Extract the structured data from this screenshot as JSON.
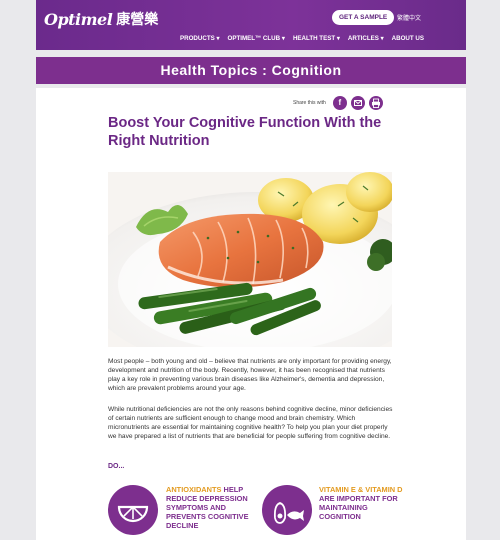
{
  "brand": {
    "name_en": "Optimel",
    "name_zh": "康營樂"
  },
  "header": {
    "get_sample": "GET A SAMPLE",
    "language": "繁體中文"
  },
  "nav": {
    "items": [
      {
        "label": "PRODUCTS ▾"
      },
      {
        "label": "OPTIMEL™ CLUB ▾"
      },
      {
        "label": "HEALTH TEST ▾"
      },
      {
        "label": "ARTICLES ▾"
      },
      {
        "label": "ABOUT US"
      }
    ]
  },
  "banner": {
    "title": "Health Topics : Cognition"
  },
  "share": {
    "label": "Share this with",
    "icons": [
      "facebook-icon",
      "email-icon",
      "print-icon"
    ]
  },
  "article": {
    "title": "Boost Your Cognitive Function With the Right Nutrition",
    "hero_image": "salmon fillet with green beans and potatoes",
    "paragraphs": [
      "Most people – both young and old – believe that nutrients are only important for providing energy, development and nutrition of the body. Recently, however, it has been recognised that nutrients play a key role in preventing various brain diseases like Alzheimer's, dementia and depression, which are prevalent problems around your age.",
      "While nutritional deficiencies are not the only reasons behind cognitive decline, minor deficiencies of certain nutrients are sufficient enough to change mood and brain chemistry. Which micronutrients are essential for maintaining cognitive health? To help you plan your diet properly we have prepared a list of nutrients that are beneficial for people suffering from cognitive decline."
    ],
    "do_label": "DO...",
    "tips": [
      {
        "highlight": "ANTIOXIDANTS",
        "text": "HELP REDUCE DEPRESSION SYMPTOMS AND PREVENTS COGNITIVE DECLINE",
        "icon": "citrus-slice-icon"
      },
      {
        "highlight": "VITAMIN E & VITAMIN D",
        "text": "ARE IMPORTANT FOR MAINTAINING COGNITION",
        "icon": "avocado-fish-icon"
      }
    ]
  },
  "colors": {
    "brand_purple": "#7d2f8e",
    "header_purple": "#6b2a8c",
    "accent_orange": "#e39b21"
  }
}
